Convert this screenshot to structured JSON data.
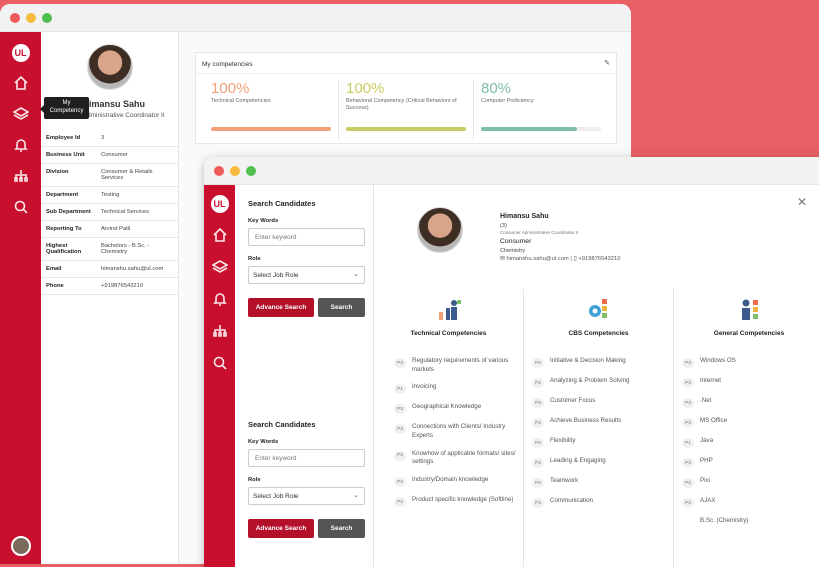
{
  "rail_logo": "UL",
  "tooltip": "My Competency",
  "profile": {
    "name": "Himansu Sahu",
    "name_visible": "imansu Sahu",
    "title": "dministrative Coordinator II",
    "rows": [
      {
        "k": "Employee Id",
        "v": "3"
      },
      {
        "k": "Business Unit",
        "v": "Consumer"
      },
      {
        "k": "Division",
        "v": "Consumer & Retails Services"
      },
      {
        "k": "Department",
        "v": "Testing"
      },
      {
        "k": "Sub Department",
        "v": "Technical Services"
      },
      {
        "k": "Reporting To",
        "v": "Arvind Patil"
      },
      {
        "k": "Highest Qualification",
        "v": "Bachelors - B.Sc. - Chemistry"
      },
      {
        "k": "Email",
        "v": "himanshu.sahu@ul.com"
      },
      {
        "k": "Phone",
        "v": "+919876543210"
      }
    ]
  },
  "competencies": {
    "header": "My competencies",
    "items": [
      {
        "pct": "100%",
        "label": "Technical Competencies",
        "color": "#f2a07a",
        "level": 1.0,
        "textcolor": "#f2a07a"
      },
      {
        "pct": "100%",
        "label": "Behavioral Competency (Critical Behaviors of Success)",
        "color": "#c9cc62",
        "level": 1.0,
        "textcolor": "#c9cc62"
      },
      {
        "pct": "80%",
        "label": "Computer Proficiency",
        "color": "#7fbfa8",
        "level": 0.8,
        "textcolor": "#7fbfa8"
      }
    ]
  },
  "search": {
    "heading": "Search Candidates",
    "keywords_label": "Key Words",
    "keywords_placeholder": "Enter keyword",
    "role_label": "Role",
    "role_value": "Select Job Role",
    "advance": "Advance Search",
    "search": "Search"
  },
  "candidate": {
    "name": "Himansu Sahu",
    "id": "(3)",
    "title": "Consumer Administrative Coordinator II",
    "unit": "Consumer",
    "dept": "Chemistry",
    "email": "himanshu.sahu@ul.com",
    "phone": "+919876543210"
  },
  "columns": [
    {
      "title": "Technical Competencies",
      "items": [
        {
          "p": "P3",
          "t": "Regulatory requirements of various markets"
        },
        {
          "p": "P1",
          "t": "Invoicing"
        },
        {
          "p": "P3",
          "t": "Geographical Knowledge"
        },
        {
          "p": "P3",
          "t": "Connections with Clients/ Industry Experts"
        },
        {
          "p": "P2",
          "t": "Knowhow of applicable formats/ sites/ settings"
        },
        {
          "p": "P3",
          "t": "Industry/Domain knowledge"
        },
        {
          "p": "P2",
          "t": "Product specific knowledge (Softline)"
        }
      ]
    },
    {
      "title": "CBS Competencies",
      "items": [
        {
          "p": "P2",
          "t": "Initiative & Decision Making"
        },
        {
          "p": "P2",
          "t": "Analyzing & Problem Solving"
        },
        {
          "p": "P3",
          "t": "Customer Focus"
        },
        {
          "p": "P2",
          "t": "Achieve Business Results"
        },
        {
          "p": "P2",
          "t": "Flexibility"
        },
        {
          "p": "P2",
          "t": "Leading & Engaging"
        },
        {
          "p": "P2",
          "t": "Teamwork"
        },
        {
          "p": "P3",
          "t": "Communication"
        }
      ]
    },
    {
      "title": "General Competencies",
      "items": [
        {
          "p": "P3",
          "t": "Windows OS"
        },
        {
          "p": "P3",
          "t": "Internet"
        },
        {
          "p": "P3",
          "t": ".Net"
        },
        {
          "p": "P3",
          "t": "MS Office"
        },
        {
          "p": "P1",
          "t": "Java"
        },
        {
          "p": "P3",
          "t": "PHP"
        },
        {
          "p": "P2",
          "t": "Pixi"
        },
        {
          "p": "P2",
          "t": "AJAX"
        },
        {
          "p": "",
          "t": "B.Sc. (Chemistry)"
        }
      ]
    }
  ]
}
